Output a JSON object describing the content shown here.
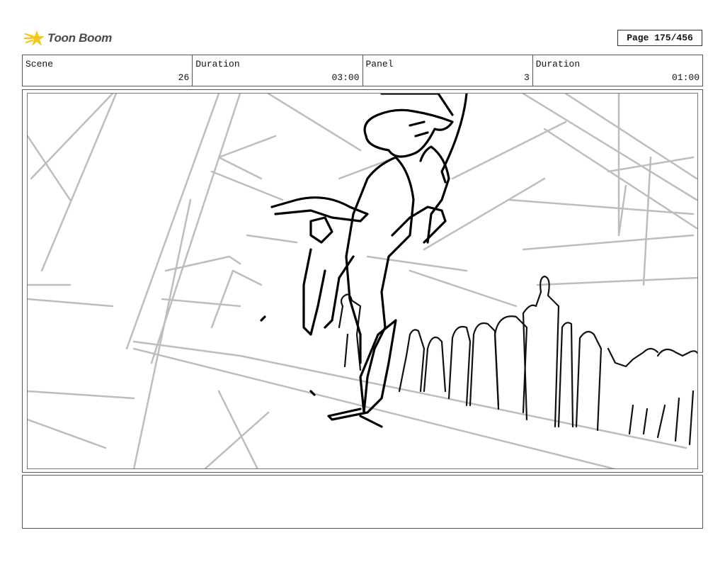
{
  "brand": {
    "name": "Toon Boom",
    "accent": "#f5c518"
  },
  "page": {
    "label": "Page 175/456"
  },
  "info": {
    "scene_label": "Scene",
    "scene_value": "26",
    "duration_label": "Duration",
    "duration_value": "03:00",
    "panel_label": "Panel",
    "panel_value": "3",
    "panel_duration_label": "Duration",
    "panel_duration_value": "01:00"
  },
  "panel": {
    "content": "storyboard sketch"
  },
  "notes": {
    "text": ""
  }
}
